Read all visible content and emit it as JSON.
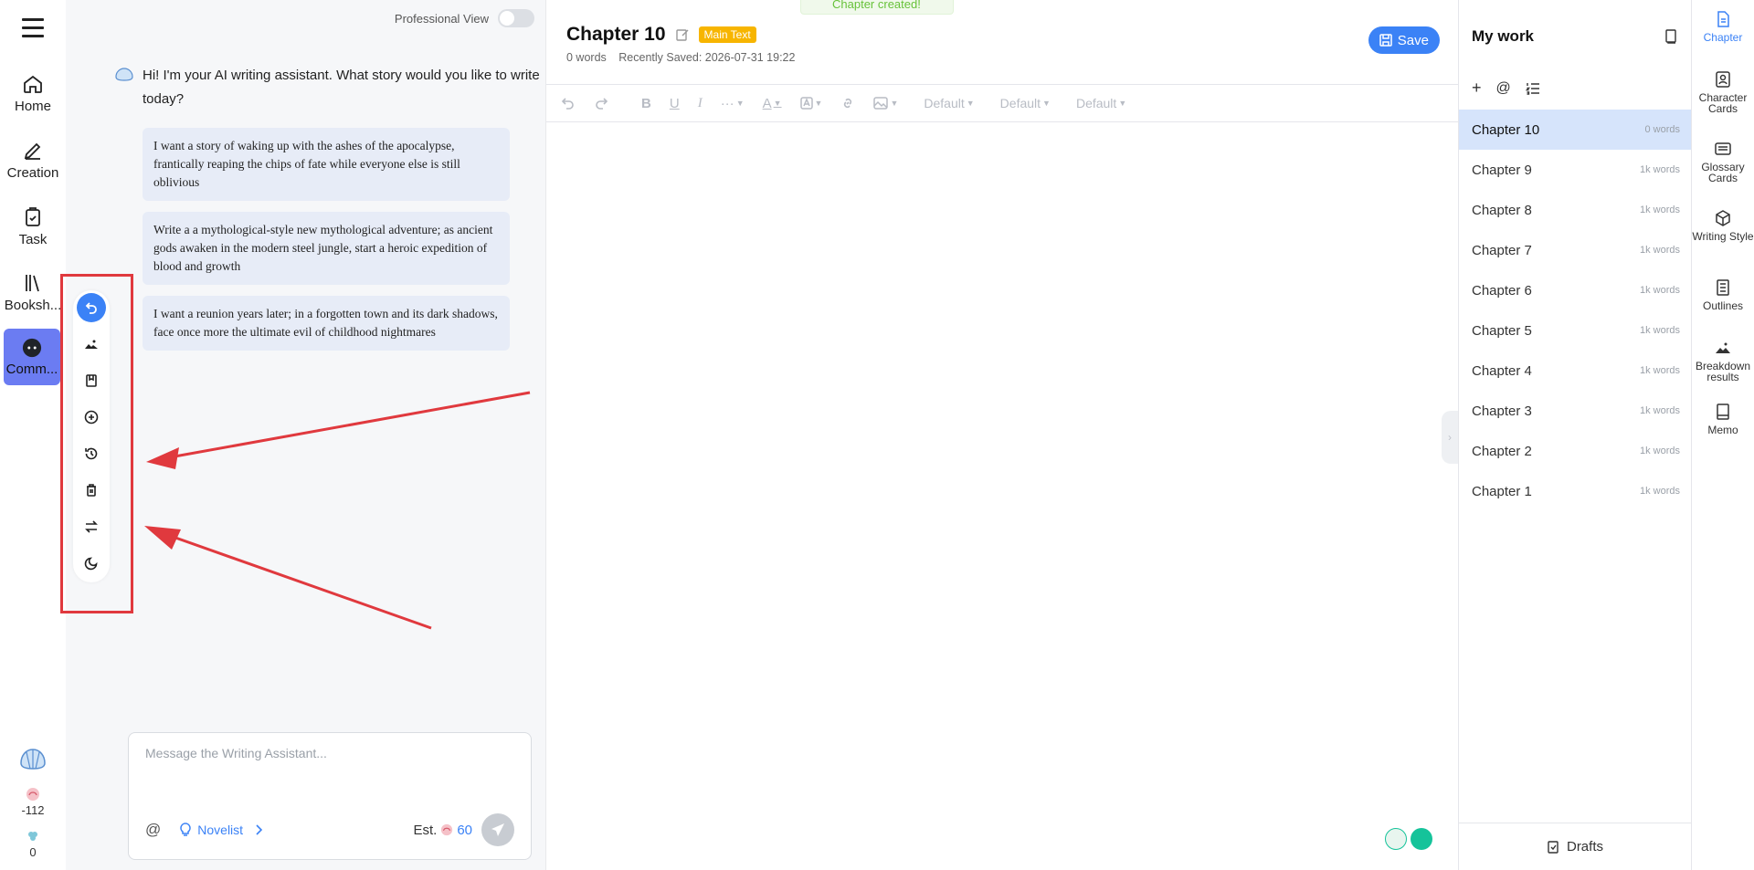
{
  "nav": {
    "items": [
      {
        "label": "Home",
        "icon": "home-icon"
      },
      {
        "label": "Creation",
        "icon": "pencil-icon"
      },
      {
        "label": "Task",
        "icon": "clipboard-check-icon"
      },
      {
        "label": "Booksh...",
        "icon": "bookshelf-icon"
      },
      {
        "label": "Comm...",
        "icon": "community-icon"
      }
    ],
    "credits": "-112",
    "points": "0"
  },
  "chat": {
    "professional_view_label": "Professional View",
    "greeting": "Hi! I'm your AI writing assistant. What story would you like to write today?",
    "suggestions": [
      "I want a story of waking up with the ashes of the apocalypse, frantically reaping the chips of fate while everyone else is still oblivious",
      "Write a a mythological-style new mythological adventure; as ancient gods awaken in the modern steel jungle, start a heroic expedition of blood and growth",
      "I want a reunion years later; in a forgotten town and its dark shadows, face once more the ultimate evil of childhood nightmares"
    ],
    "toolbar_icons": [
      "undo-icon",
      "landscape-icon",
      "save-book-icon",
      "add-circle-icon",
      "history-icon",
      "trash-icon",
      "swap-icon",
      "theme-icon"
    ],
    "input_placeholder": "Message the Writing Assistant...",
    "at_symbol": "@",
    "mode_label": "Novelist",
    "est_label": "Est.",
    "est_value": "60"
  },
  "editor": {
    "toast": "Chapter created!",
    "chapter_title": "Chapter 10",
    "badge": "Main Text",
    "word_count": "0 words",
    "recently_saved": "Recently Saved: 2026-07-31 19:22",
    "save_label": "Save",
    "format_selects": [
      "Default",
      "Default",
      "Default"
    ]
  },
  "work": {
    "title": "My work",
    "chapters": [
      {
        "name": "Chapter 10",
        "words": "0 words"
      },
      {
        "name": "Chapter 9",
        "words": "1k words"
      },
      {
        "name": "Chapter 8",
        "words": "1k words"
      },
      {
        "name": "Chapter 7",
        "words": "1k words"
      },
      {
        "name": "Chapter 6",
        "words": "1k words"
      },
      {
        "name": "Chapter 5",
        "words": "1k words"
      },
      {
        "name": "Chapter 4",
        "words": "1k words"
      },
      {
        "name": "Chapter 3",
        "words": "1k words"
      },
      {
        "name": "Chapter 2",
        "words": "1k words"
      },
      {
        "name": "Chapter 1",
        "words": "1k words"
      }
    ],
    "drafts_label": "Drafts"
  },
  "rail": {
    "items": [
      {
        "label": "Chapter"
      },
      {
        "label": "Character Cards"
      },
      {
        "label": "Glossary Cards"
      },
      {
        "label": "Writing Style"
      },
      {
        "label": "Outlines"
      },
      {
        "label": "Breakdown results"
      },
      {
        "label": "Memo"
      }
    ]
  },
  "colors": {
    "accent": "#3b82f6",
    "badge": "#f7b500",
    "annotation": "#e0393e",
    "active_chapter": "#d6e4fb"
  }
}
